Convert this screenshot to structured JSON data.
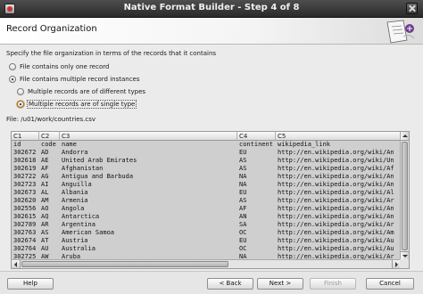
{
  "window": {
    "title": "Native Format Builder - Step 4 of 8"
  },
  "header": {
    "title": "Record Organization"
  },
  "intro_text": "Specify the file organization in terms of the records that it contains",
  "options": {
    "single": "File contains only one record",
    "multiple": "File contains multiple record instances",
    "different": "Multiple records are of different types",
    "same": "Multiple records are of single type",
    "selected_top": "multiple",
    "selected_sub": "same"
  },
  "file_label": "File: /u01/work/countries.csv",
  "grid": {
    "headers": [
      "C1",
      "C2",
      "C3",
      "C4",
      "C5"
    ],
    "rows": [
      [
        "id",
        "code",
        "name",
        "continent",
        "wikipedia_link"
      ],
      [
        "302672",
        "AD",
        "Andorra",
        "EU",
        "http://en.wikipedia.org/wiki/An"
      ],
      [
        "302618",
        "AE",
        "United Arab Emirates",
        "AS",
        "http://en.wikipedia.org/wiki/Un"
      ],
      [
        "302619",
        "AF",
        "Afghanistan",
        "AS",
        "http://en.wikipedia.org/wiki/Af"
      ],
      [
        "302722",
        "AG",
        "Antigua and Barbuda",
        "NA",
        "http://en.wikipedia.org/wiki/An"
      ],
      [
        "302723",
        "AI",
        "Anguilla",
        "NA",
        "http://en.wikipedia.org/wiki/An"
      ],
      [
        "302673",
        "AL",
        "Albania",
        "EU",
        "http://en.wikipedia.org/wiki/Al"
      ],
      [
        "302620",
        "AM",
        "Armenia",
        "AS",
        "http://en.wikipedia.org/wiki/Ar"
      ],
      [
        "302556",
        "AO",
        "Angola",
        "AF",
        "http://en.wikipedia.org/wiki/An"
      ],
      [
        "302615",
        "AQ",
        "Antarctica",
        "AN",
        "http://en.wikipedia.org/wiki/An"
      ],
      [
        "302789",
        "AR",
        "Argentina",
        "SA",
        "http://en.wikipedia.org/wiki/Ar"
      ],
      [
        "302763",
        "AS",
        "American Samoa",
        "OC",
        "http://en.wikipedia.org/wiki/Am"
      ],
      [
        "302674",
        "AT",
        "Austria",
        "EU",
        "http://en.wikipedia.org/wiki/Au"
      ],
      [
        "302764",
        "AU",
        "Australia",
        "OC",
        "http://en.wikipedia.org/wiki/Au"
      ],
      [
        "302725",
        "AW",
        "Aruba",
        "NA",
        "http://en.wikipedia.org/wiki/Ar"
      ]
    ]
  },
  "footer": {
    "help": "Help",
    "back": "< Back",
    "next": "Next >",
    "finish": "Finish",
    "cancel": "Cancel"
  }
}
